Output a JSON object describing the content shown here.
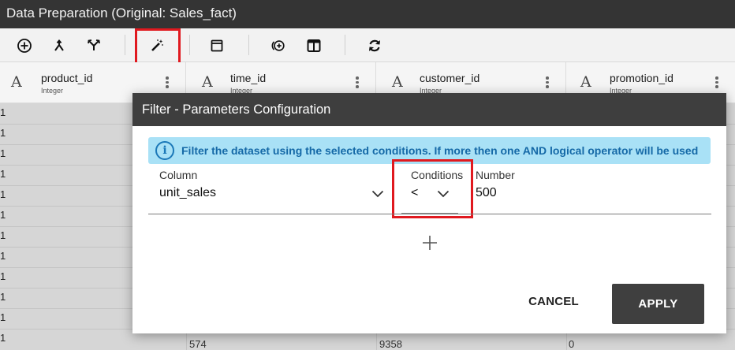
{
  "window": {
    "title": "Data Preparation (Original: Sales_fact)"
  },
  "toolbar": {
    "buttons": [
      {
        "icon": "add-circle-icon"
      },
      {
        "icon": "merge-icon"
      },
      {
        "icon": "split-icon"
      },
      {
        "icon": "magic-wand-icon",
        "highlighted": true
      },
      {
        "icon": "window-icon"
      },
      {
        "icon": "add-column-icon"
      },
      {
        "icon": "columns-icon"
      },
      {
        "icon": "refresh-icon"
      }
    ]
  },
  "columns": [
    {
      "name": "product_id",
      "type": "Integer"
    },
    {
      "name": "time_id",
      "type": "Integer"
    },
    {
      "name": "customer_id",
      "type": "Integer"
    },
    {
      "name": "promotion_id",
      "type": "Integer"
    }
  ],
  "grid": {
    "first_col_values": [
      "1",
      "1",
      "1",
      "1",
      "1",
      "1",
      "1",
      "1",
      "1",
      "1",
      "1",
      "1"
    ],
    "last_row": [
      "574",
      "9358",
      "0"
    ]
  },
  "dialog": {
    "title": "Filter - Parameters Configuration",
    "info": "Filter the dataset using the selected conditions. If more then one AND logical operator will be used",
    "column_label": "Column",
    "column_value": "unit_sales",
    "conditions_label": "Conditions",
    "conditions_value": "<",
    "number_label": "Number",
    "number_value": "500",
    "cancel_label": "CANCEL",
    "apply_label": "APPLY"
  },
  "colors": {
    "highlight": "#e0191f",
    "info_bg": "#a9e1f6",
    "info_text": "#1569a7",
    "dialog_header": "#3e3e3e",
    "titlebar": "#343434"
  }
}
